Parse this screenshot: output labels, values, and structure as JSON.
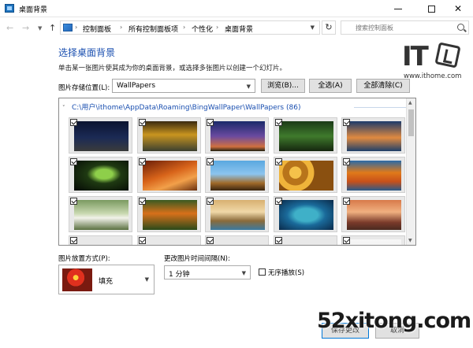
{
  "window": {
    "title": "桌面背景"
  },
  "address": {
    "crumbs": [
      "控制面板",
      "所有控制面板项",
      "个性化",
      "桌面背景"
    ],
    "search_placeholder": "搜索控制面板"
  },
  "content": {
    "heading": "选择桌面背景",
    "description": "单击某一张图片使其成为你的桌面背景，或选择多张图片以创建一个幻灯片。",
    "location_label": "图片存储位置(L):",
    "location_value": "WallPapers",
    "browse_label": "浏览(B)...",
    "select_all_label": "全选(A)",
    "clear_all_label": "全部清除(C)"
  },
  "gallery": {
    "folder": "C:\\用户\\ithome\\AppData\\Roaming\\BingWallPaper\\WallPapers (86)",
    "tiles": [
      {
        "bg": "linear-gradient(180deg,#0b1430 0%,#1b2a55 55%,#3b3b3b 100%)"
      },
      {
        "bg": "linear-gradient(180deg,#3a2a10 0%,#c9951f 45%,#3b4030 100%)"
      },
      {
        "bg": "linear-gradient(180deg,#1a2a6a 0%,#6a4aa0 50%,#d07040 85%,#202010 100%)"
      },
      {
        "bg": "linear-gradient(180deg,#1b3a18 0%,#3f7a2c 50%,#15260f 100%)"
      },
      {
        "bg": "linear-gradient(180deg,#1c3a6a 0%,#e08a40 55%,#1e3f6a 100%)"
      },
      {
        "bg": "radial-gradient(ellipse at 55% 45%,#8ecf4a 0 20%,#1f3a12 40%,#050805 100%)"
      },
      {
        "bg": "linear-gradient(160deg,#6a1e08 0%,#d8641a 45%,#f2a04a 70%,#6a3010 100%)"
      },
      {
        "bg": "linear-gradient(180deg,#5aa8e0 0%,#8cc4ee 45%,#a06a2a 75%,#3a2510 100%)"
      },
      {
        "bg": "radial-gradient(circle at 30% 40%,#f5c24a 0 14%,#b8741a 15% 30%,#f0b43a 31% 44%,#8a5010 45% 100%)"
      },
      {
        "bg": "linear-gradient(180deg,#2a6aa8 0%,#e07a1a 40%,#c8501a 70%,#2a5a8a 100%)"
      },
      {
        "bg": "linear-gradient(180deg,#7a9a60 0%,#c8d8b0 45%,#f2f2ea 60%,#5a7040 100%)"
      },
      {
        "bg": "linear-gradient(180deg,#3a5a22 0%,#d8701a 45%,#2a4a1a 100%)"
      },
      {
        "bg": "linear-gradient(180deg,#d8b070 0%,#f0d8a8 40%,#8a6a3a 70%,#3a7aa0 100%)"
      },
      {
        "bg": "radial-gradient(ellipse at 50% 50%,#3fb0c8 0 30%,#1a6a9a 50%,#0a2a4a 100%)"
      },
      {
        "bg": "linear-gradient(180deg,#d87a4a 0%,#f0b080 40%,#7a3a2a 75%,#4a2a20 100%)"
      }
    ]
  },
  "picture_position": {
    "label": "图片放置方式(P):",
    "value": "填充"
  },
  "interval": {
    "label": "更改图片时间间隔(N):",
    "value": "1 分钟"
  },
  "shuffle_label": "无序播放(S)",
  "buttons": {
    "save": "保存更改",
    "cancel": "取消"
  },
  "watermarks": {
    "logo_text": "IT",
    "logo_domain": "www.ithome.com",
    "site": "52xitong.com"
  }
}
